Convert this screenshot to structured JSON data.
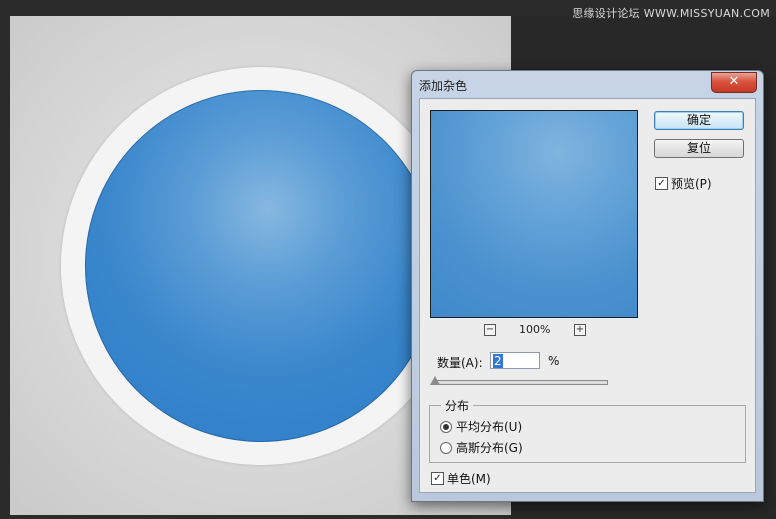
{
  "watermark": "思缘设计论坛 WWW.MISSYUAN.COM",
  "dialog": {
    "title": "添加杂色",
    "close_label": "✕",
    "ok_label": "确定",
    "reset_label": "复位",
    "preview_label": "预览(P)",
    "preview_checked": true,
    "zoom_minus": "−",
    "zoom_level": "100%",
    "zoom_plus": "+",
    "amount_label": "数量(A):",
    "amount_value": "2",
    "amount_unit": "%",
    "distribution_title": "分布",
    "uniform_label": "平均分布(U)",
    "gaussian_label": "高斯分布(G)",
    "selected_distribution": "uniform",
    "monochrome_label": "单色(M)",
    "monochrome_checked": true
  },
  "colors": {
    "ball_blue": "#2c7cc8",
    "ring_white": "#f4f4f4",
    "canvas_gray": "#dcdcdc",
    "dark_bg": "#2b2b2b",
    "close_red": "#c43a25"
  }
}
